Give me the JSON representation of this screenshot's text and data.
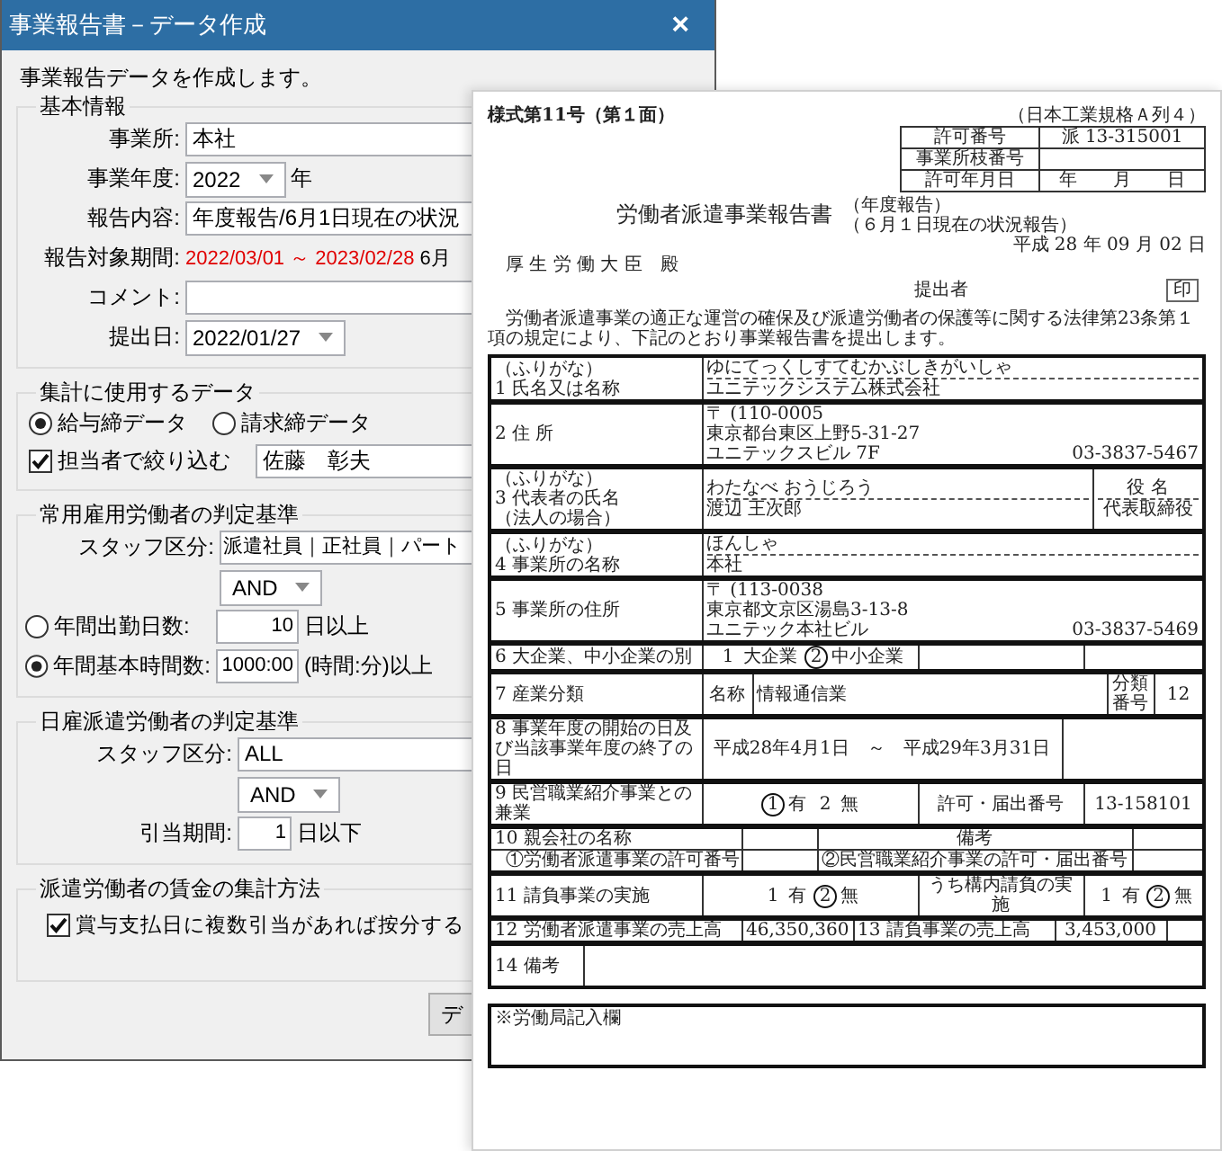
{
  "window": {
    "title": "事業報告書－データ作成",
    "close": "×"
  },
  "intro": "事業報告データを作成します。",
  "basic": {
    "title": "基本情報",
    "fields": [
      {
        "kind": "text",
        "label": "事業所:",
        "value": "本社"
      },
      {
        "kind": "select",
        "label": "事業年度:",
        "value": "2022",
        "suffix": "年"
      },
      {
        "kind": "text",
        "label": "報告内容:",
        "value": "年度報告/6月1日現在の状況"
      },
      {
        "kind": "period",
        "label": "報告対象期間:",
        "value": "2022/03/01 ～ 2023/02/28",
        "suffix": "6月"
      },
      {
        "kind": "text",
        "label": "コメント:"
      },
      {
        "kind": "select",
        "label": "提出日:",
        "value": "2022/01/27"
      }
    ]
  },
  "source": {
    "title": "集計に使用するデータ",
    "options": [
      {
        "label": "給与締データ",
        "selected": true
      },
      {
        "label": "請求締データ",
        "selected": false
      }
    ],
    "filter": {
      "label": "担当者で絞り込む",
      "checked": true,
      "value": "佐藤　彰夫"
    }
  },
  "regular": {
    "title": "常用雇用労働者の判定基準",
    "staff_label": "スタッフ区分:",
    "staff_value": "派遣社員｜正社員｜パート",
    "operator": "AND",
    "criteria": [
      {
        "label": "年間出勤日数:",
        "value": "10",
        "suffix": "日以上",
        "selected": false
      },
      {
        "label": "年間基本時間数:",
        "value": "1000:00",
        "suffix": "(時間:分)以上",
        "selected": true
      }
    ]
  },
  "daily": {
    "title": "日雇派遣労働者の判定基準",
    "staff_label": "スタッフ区分:",
    "staff_value": "ALL",
    "operator": "AND",
    "period_label": "引当期間:",
    "period_value": "1",
    "period_suffix": "日以下"
  },
  "wage": {
    "title": "派遣労働者の賃金の集計方法",
    "option": {
      "label": "賞与支払日に複数引当があれば按分する",
      "checked": true
    }
  },
  "button": "デ",
  "document": {
    "form_no": "様式第11号（第１面）",
    "paper": "（日本工業規格Ａ列４）",
    "permit": [
      {
        "label": "許可番号",
        "value": "派 13-315001"
      },
      {
        "label": "事業所枝番号"
      },
      {
        "label": "許可年月日",
        "value": "年　　月　　日"
      }
    ],
    "title": "労働者派遣事業報告書",
    "report_types": [
      "（年度報告）",
      "（６月１日現在の状況報告）"
    ],
    "date": "平成 28 年 09 月 02 日",
    "addressee": "厚 生 労 働 大 臣　殿",
    "submitter": "提出者",
    "seal": "印",
    "intro": "労働者派遣事業の適正な運営の確保及び派遣労働者の保護等に関する法律第23条第１項の規定により、下記のとおり事業報告書を提出します。",
    "rows": [
      {
        "kind": "name",
        "furigana_label": "（ふりがな）",
        "label": "1 氏名又は名称",
        "furigana": "ゆにてっくしすてむかぶしきがいしゃ",
        "value": "ユニテックシステム株式会社"
      },
      {
        "kind": "address",
        "label": "2 住 所",
        "lines": [
          "〒 (110-0005",
          "東京都台東区上野5-31-27",
          "ユニテックスビル 7F"
        ],
        "phone": "03-3837-5467"
      },
      {
        "kind": "rep",
        "furigana_label": "（ふりがな）",
        "label": "3 代表者の氏名",
        "label_note": "（法人の場合）",
        "furigana": "わたなべ おうじろう",
        "value": "渡辺 王次郎",
        "title_label": "役 名",
        "title": "代表取締役"
      },
      {
        "kind": "name",
        "furigana_label": "（ふりがな）",
        "label": "4 事業所の名称",
        "furigana": "ほんしゃ",
        "value": "本社"
      },
      {
        "kind": "address",
        "label": "5 事業所の住所",
        "lines": [
          "〒 (113-0038",
          "東京都文京区湯島3-13-8",
          "ユニテック本社ビル"
        ],
        "phone": "03-3837-5469"
      },
      {
        "kind": "choice",
        "label": "6 大企業、中小企業の別",
        "options": [
          {
            "number": "1",
            "text": "大企業",
            "selected": false
          },
          {
            "number": "2",
            "text": "中小企業",
            "selected": true
          }
        ]
      },
      {
        "kind": "industry",
        "label": "7 産業分類",
        "name_label": "名称",
        "value": "情報通信業",
        "code_label": "分類番号",
        "code": "12"
      },
      {
        "kind": "period",
        "label": "8 事業年度の開始の日及び当該事業年度の終了の日",
        "value": "平成28年4月1日　～　平成29年3月31日"
      },
      {
        "kind": "choice",
        "label": "9 民営職業紹介事業との兼業",
        "options": [
          {
            "number": "1",
            "text": "有",
            "selected": true
          },
          {
            "number": "2",
            "text": "無",
            "selected": false
          }
        ],
        "extra_label": "許可・届出番号",
        "extra_value": "13-158101"
      },
      {
        "kind": "parent",
        "label": "10 親会社の名称",
        "note_label": "備考",
        "sub_labels": [
          "①労働者派遣事業の許可番号",
          "②民営職業紹介事業の許可・届出番号"
        ]
      },
      {
        "kind": "choice",
        "label": "11 請負事業の実施",
        "options": [
          {
            "number": "1",
            "text": "有",
            "selected": false
          },
          {
            "number": "2",
            "text": "無",
            "selected": true
          }
        ],
        "extra_label": "うち構内請負の実施",
        "extra_options": [
          {
            "number": "1",
            "text": "有",
            "selected": false
          },
          {
            "number": "2",
            "text": "無",
            "selected": true
          }
        ]
      },
      {
        "kind": "sales",
        "items": [
          {
            "label": "12 労働者派遣事業の売上高",
            "value": "46,350,360"
          },
          {
            "label": "13 請負事業の売上高",
            "value": "3,453,000"
          }
        ]
      },
      {
        "kind": "notes",
        "label": "14 備考"
      }
    ],
    "office_note": "※労働局記入欄"
  }
}
